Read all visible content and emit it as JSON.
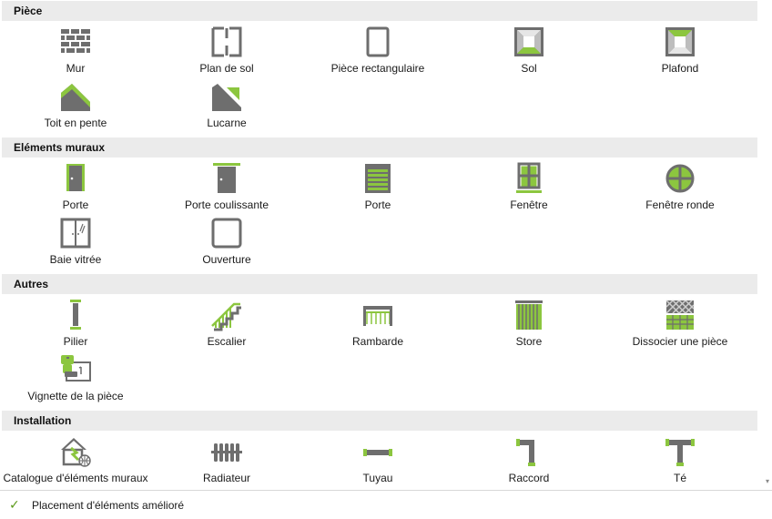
{
  "sections": [
    {
      "title": "Pièce",
      "items": [
        "Mur",
        "Plan de sol",
        "Pièce rectangulaire",
        "Sol",
        "Plafond",
        "Toit en pente",
        "Lucarne"
      ]
    },
    {
      "title": "Eléments muraux",
      "items": [
        "Porte",
        "Porte coulissante",
        "Porte",
        "Fenêtre",
        "Fenêtre ronde",
        "Baie vitrée",
        "Ouverture"
      ]
    },
    {
      "title": "Autres",
      "items": [
        "Pilier",
        "Escalier",
        "Rambarde",
        "Store",
        "Dissocier une pièce",
        "Vignette de la pièce"
      ]
    },
    {
      "title": "Installation",
      "items": [
        "Catalogue d'éléments muraux",
        "Radiateur",
        "Tuyau",
        "Raccord",
        "Té"
      ]
    }
  ],
  "footer": {
    "label": "Placement d'éléments amélioré",
    "checked": true
  },
  "colors": {
    "accent": "#8cc63f",
    "icon_gray": "#707070",
    "header_bg": "#ebebeb"
  }
}
